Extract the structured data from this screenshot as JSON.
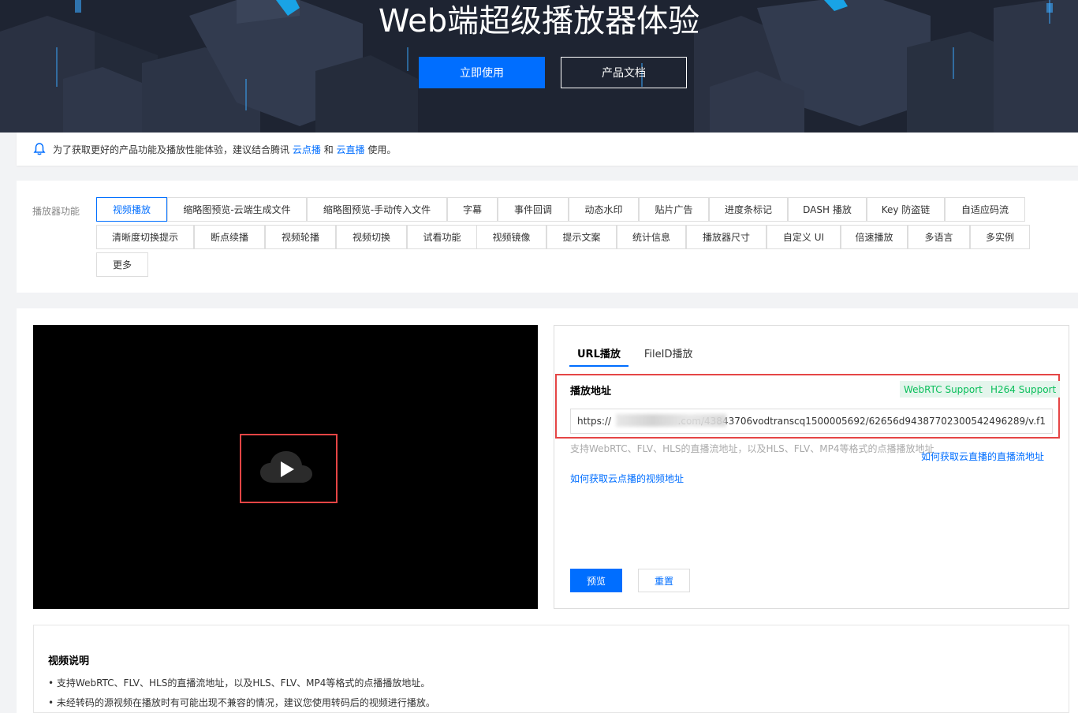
{
  "hero": {
    "title": "Web端超级播放器体验",
    "primary_button": "立即使用",
    "secondary_button": "产品文档"
  },
  "notice": {
    "icon": "bell-icon",
    "text_before": "为了获取更好的产品功能及播放性能体验，建议结合腾讯",
    "link1": "云点播",
    "text_mid": "和",
    "link2": "云直播",
    "text_after": "使用。"
  },
  "features": {
    "label": "播放器功能",
    "tags": [
      "视频播放",
      "缩略图预览-云端生成文件",
      "缩略图预览-手动传入文件",
      "字幕",
      "事件回调",
      "动态水印",
      "贴片广告",
      "进度条标记",
      "DASH 播放",
      "Key 防盗链",
      "自适应码流",
      "清晰度切换提示",
      "断点续播",
      "视频轮播",
      "视频切换",
      "试看功能",
      "视频镜像",
      "提示文案",
      "统计信息",
      "播放器尺寸",
      "自定义 UI",
      "倍速播放",
      "多语言",
      "多实例",
      "更多"
    ],
    "active_index": 0
  },
  "player": {
    "tabs": [
      "URL播放",
      "FileID播放"
    ],
    "active_tab": 0,
    "address_label": "播放地址",
    "badges": [
      "WebRTC Support",
      "H264 Support"
    ],
    "url_prefix": "https://",
    "url_suffix": ".com/43843706vodtranscq1500005692/62656d94387702300542496289/v.f1",
    "hint": "支持WebRTC、FLV、HLS的直播流地址，以及HLS、FLV、MP4等格式的点播播放地址",
    "link_live": "如何获取云直播的直播流地址",
    "link_vod": "如何获取云点播的视频地址",
    "preview_button": "预览",
    "reset_button": "重置"
  },
  "description": {
    "title": "视频说明",
    "items": [
      "支持WebRTC、FLV、HLS的直播流地址，以及HLS、FLV、MP4等格式的点播播放地址。",
      "未经转码的源视频在播放时有可能出现不兼容的情况，建议您使用转码后的视频进行播放。"
    ]
  },
  "colors": {
    "primary": "#006eff",
    "highlight": "#e54545",
    "badge_green": "#0abf5b"
  }
}
